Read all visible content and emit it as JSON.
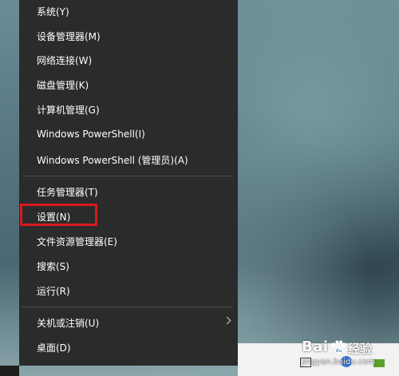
{
  "menu": {
    "items": [
      {
        "label": "系统(Y)"
      },
      {
        "label": "设备管理器(M)"
      },
      {
        "label": "网络连接(W)"
      },
      {
        "label": "磁盘管理(K)"
      },
      {
        "label": "计算机管理(G)"
      },
      {
        "label": "Windows PowerShell(I)"
      },
      {
        "label": "Windows PowerShell (管理员)(A)"
      },
      {
        "label": "任务管理器(T)"
      },
      {
        "label": "设置(N)"
      },
      {
        "label": "文件资源管理器(E)"
      },
      {
        "label": "搜索(S)"
      },
      {
        "label": "运行(R)"
      },
      {
        "label": "关机或注销(U)"
      },
      {
        "label": "桌面(D)"
      }
    ]
  },
  "watermark": {
    "brand": "Bai",
    "brand2": "经验",
    "url": "jingyan.baidu.com"
  },
  "colors": {
    "menu_bg": "#2b2b2b",
    "highlight": "#d9191f"
  }
}
